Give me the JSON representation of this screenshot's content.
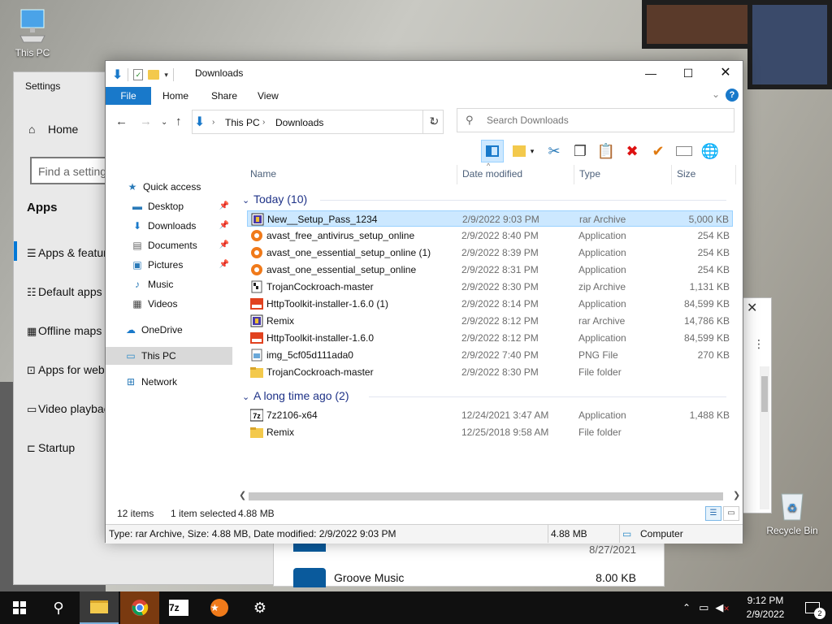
{
  "desktop": {
    "this_pc_label": "This PC",
    "recycle_bin_label": "Recycle Bin"
  },
  "settings": {
    "title": "Settings",
    "home": "Home",
    "find_placeholder": "Find a setting",
    "section": "Apps",
    "nav": [
      "Apps & features",
      "Default apps",
      "Offline maps",
      "Apps for websites",
      "Video playback",
      "Startup"
    ]
  },
  "background_panel": {
    "date": "8/27/2021",
    "item_name": "Groove Music",
    "item_size": "8.00 KB"
  },
  "explorer": {
    "title": "Downloads",
    "ribbon_tabs": [
      "File",
      "Home",
      "Share",
      "View"
    ],
    "breadcrumb": [
      "This PC",
      "Downloads"
    ],
    "search_placeholder": "Search Downloads",
    "nav": {
      "quick_access": "Quick access",
      "items": [
        "Desktop",
        "Downloads",
        "Documents",
        "Pictures",
        "Music",
        "Videos"
      ],
      "onedrive": "OneDrive",
      "this_pc": "This PC",
      "network": "Network"
    },
    "columns": [
      "Name",
      "Date modified",
      "Type",
      "Size"
    ],
    "groups": [
      {
        "label": "Today (10)",
        "rows": [
          {
            "name": "New__Setup_Pass_1234",
            "date": "2/9/2022 9:03 PM",
            "type": "rar Archive",
            "size": "5,000 KB",
            "icon": "rar-icon",
            "selected": true
          },
          {
            "name": "avast_free_antivirus_setup_online",
            "date": "2/9/2022 8:40 PM",
            "type": "Application",
            "size": "254 KB",
            "icon": "avast-icon"
          },
          {
            "name": "avast_one_essential_setup_online (1)",
            "date": "2/9/2022 8:39 PM",
            "type": "Application",
            "size": "254 KB",
            "icon": "avast-icon"
          },
          {
            "name": "avast_one_essential_setup_online",
            "date": "2/9/2022 8:31 PM",
            "type": "Application",
            "size": "254 KB",
            "icon": "avast-icon"
          },
          {
            "name": "TrojanCockroach-master",
            "date": "2/9/2022 8:30 PM",
            "type": "zip Archive",
            "size": "1,131 KB",
            "icon": "zip-icon"
          },
          {
            "name": "HttpToolkit-installer-1.6.0 (1)",
            "date": "2/9/2022 8:14 PM",
            "type": "Application",
            "size": "84,599 KB",
            "icon": "httptoolkit-icon"
          },
          {
            "name": "Remix",
            "date": "2/9/2022 8:12 PM",
            "type": "rar Archive",
            "size": "14,786 KB",
            "icon": "rar-icon"
          },
          {
            "name": "HttpToolkit-installer-1.6.0",
            "date": "2/9/2022 8:12 PM",
            "type": "Application",
            "size": "84,599 KB",
            "icon": "httptoolkit-icon"
          },
          {
            "name": "img_5cf05d111ada0",
            "date": "2/9/2022 7:40 PM",
            "type": "PNG File",
            "size": "270 KB",
            "icon": "image-icon"
          },
          {
            "name": "TrojanCockroach-master",
            "date": "2/9/2022 8:30 PM",
            "type": "File folder",
            "size": "",
            "icon": "folder-icon"
          }
        ]
      },
      {
        "label": "A long time ago (2)",
        "rows": [
          {
            "name": "7z2106-x64",
            "date": "12/24/2021 3:47 AM",
            "type": "Application",
            "size": "1,488 KB",
            "icon": "7zip-icon"
          },
          {
            "name": "Remix",
            "date": "12/25/2018 9:58 AM",
            "type": "File folder",
            "size": "",
            "icon": "folder-icon"
          }
        ]
      }
    ],
    "status": {
      "item_count": "12 items",
      "selected": "1 item selected",
      "selected_size": "4.88 MB"
    },
    "details": {
      "info": "Type: rar Archive, Size: 4.88 MB, Date modified: 2/9/2022 9:03 PM",
      "size": "4.88 MB",
      "location": "Computer"
    }
  },
  "taskbar": {
    "time": "9:12 PM",
    "date": "2/9/2022",
    "notifications": "2"
  },
  "colors": {
    "accent": "#1979ca",
    "selection": "#cce8ff",
    "group_header": "#1e3287"
  }
}
